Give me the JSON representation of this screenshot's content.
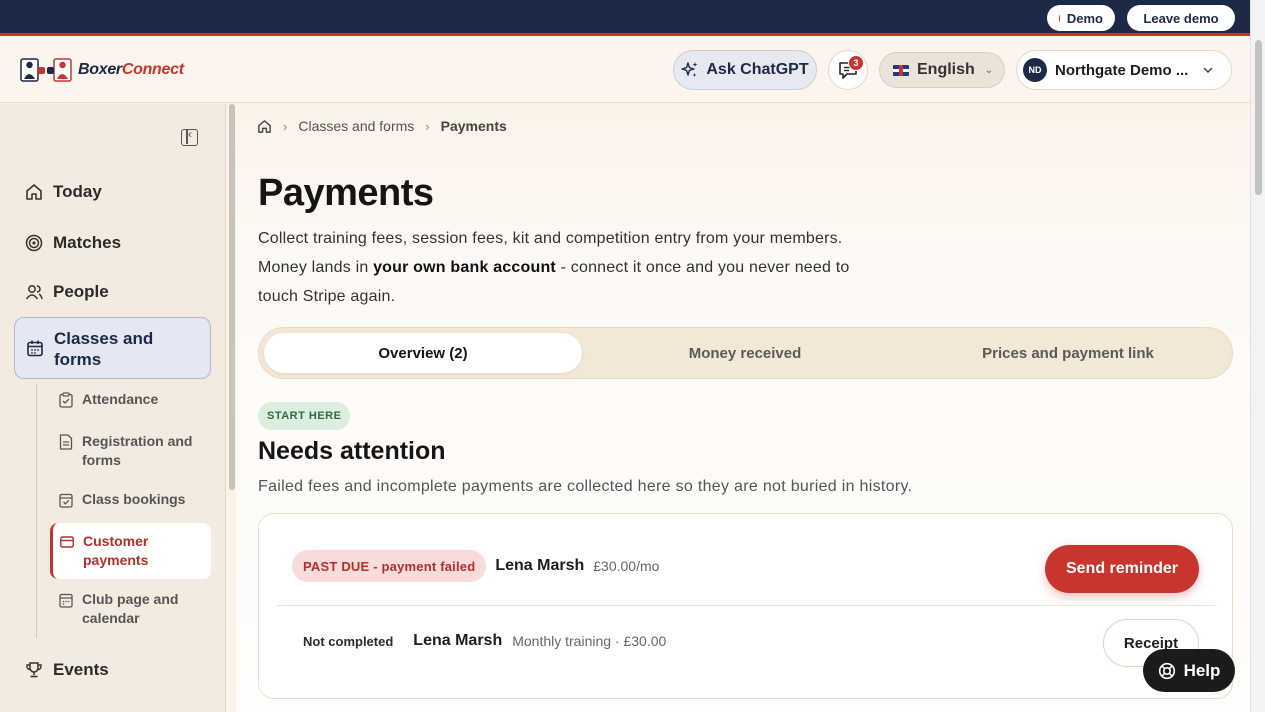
{
  "demo_bar": {
    "demo_label": "Demo",
    "leave_label": "Leave demo"
  },
  "header": {
    "brand_part1": "Boxer",
    "brand_part2": "Connect",
    "ask_chatgpt": "Ask ChatGPT",
    "messages_count": "3",
    "language": "English",
    "org_initials": "ND",
    "org_name": "Northgate Demo ..."
  },
  "sidebar": {
    "items": [
      {
        "label": "Today"
      },
      {
        "label": "Matches"
      },
      {
        "label": "People"
      },
      {
        "label": "Classes and forms"
      },
      {
        "label": "Events"
      }
    ],
    "subitems": [
      {
        "label": "Attendance"
      },
      {
        "label": "Registration and forms"
      },
      {
        "label": "Class bookings"
      },
      {
        "label": "Customer payments"
      },
      {
        "label": "Club page and calendar"
      }
    ]
  },
  "breadcrumb": {
    "section": "Classes and forms",
    "current": "Payments"
  },
  "page": {
    "title": "Payments",
    "desc_before": "Collect training fees, session fees, kit and competition entry from your members. Money lands in ",
    "desc_bold": "your own bank account",
    "desc_after": " - connect it once and you never need to touch Stripe again."
  },
  "tabs": [
    {
      "label": "Overview (2)"
    },
    {
      "label": "Money received"
    },
    {
      "label": "Prices and payment link"
    }
  ],
  "attention": {
    "badge": "START HERE",
    "title": "Needs attention",
    "desc": "Failed fees and incomplete payments are collected here so they are not buried in history.",
    "rows": [
      {
        "status": "PAST DUE - payment failed",
        "name": "Lena Marsh",
        "meta": "£30.00/mo",
        "action": "Send reminder"
      },
      {
        "status": "Not completed",
        "name": "Lena Marsh",
        "meta": "Monthly training · £30.00",
        "action": "Receipt"
      }
    ]
  },
  "help": {
    "label": "Help"
  },
  "colors": {
    "accent": "#c8352f",
    "navy": "#1c2a45",
    "success_bg": "#dcefdf"
  }
}
